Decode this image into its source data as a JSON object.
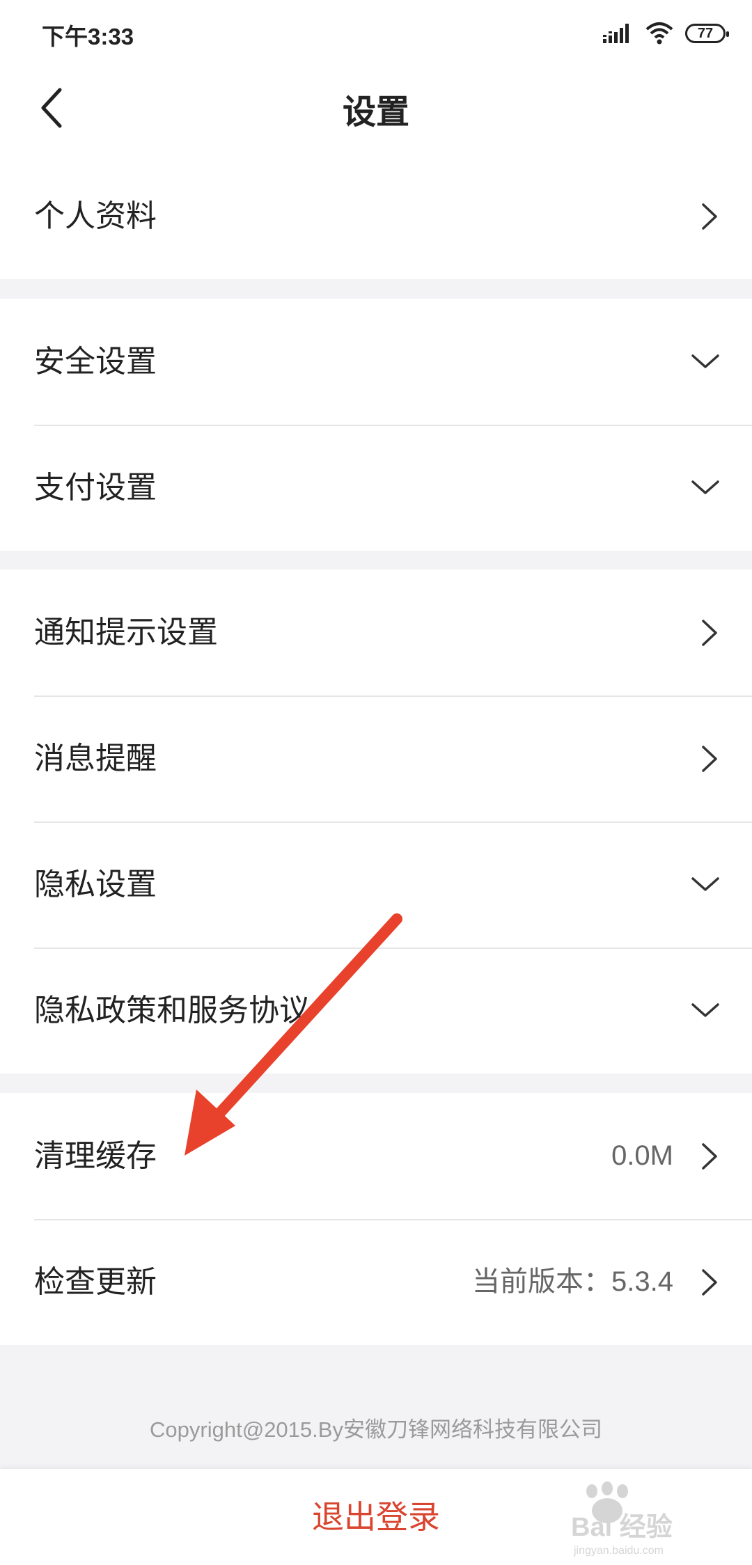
{
  "status_bar": {
    "time": "下午3:33",
    "battery": "77"
  },
  "header": {
    "title": "设置"
  },
  "sections": [
    {
      "rows": [
        {
          "label": "个人资料",
          "value": "",
          "chevron": "chevron-right"
        }
      ]
    },
    {
      "rows": [
        {
          "label": "安全设置",
          "value": "",
          "chevron": "chevron-down"
        },
        {
          "label": "支付设置",
          "value": "",
          "chevron": "chevron-down"
        }
      ]
    },
    {
      "rows": [
        {
          "label": "通知提示设置",
          "value": "",
          "chevron": "chevron-right"
        },
        {
          "label": "消息提醒",
          "value": "",
          "chevron": "chevron-right"
        },
        {
          "label": "隐私设置",
          "value": "",
          "chevron": "chevron-down"
        },
        {
          "label": "隐私政策和服务协议",
          "value": "",
          "chevron": "chevron-down"
        }
      ]
    },
    {
      "rows": [
        {
          "label": "清理缓存",
          "value": "0.0M",
          "chevron": "chevron-right"
        },
        {
          "label": "检查更新",
          "value": "当前版本：5.3.4",
          "chevron": "chevron-right"
        }
      ]
    }
  ],
  "footer": {
    "copyright": "Copyright@2015.By安徽刀锋网络科技有限公司",
    "logout_label": "退出登录"
  },
  "watermark": {
    "text": "Bai 经验",
    "subtext": "jingyan.baidu.com"
  },
  "colors": {
    "accent": "#d9452f",
    "arrow": "#e8412c"
  }
}
